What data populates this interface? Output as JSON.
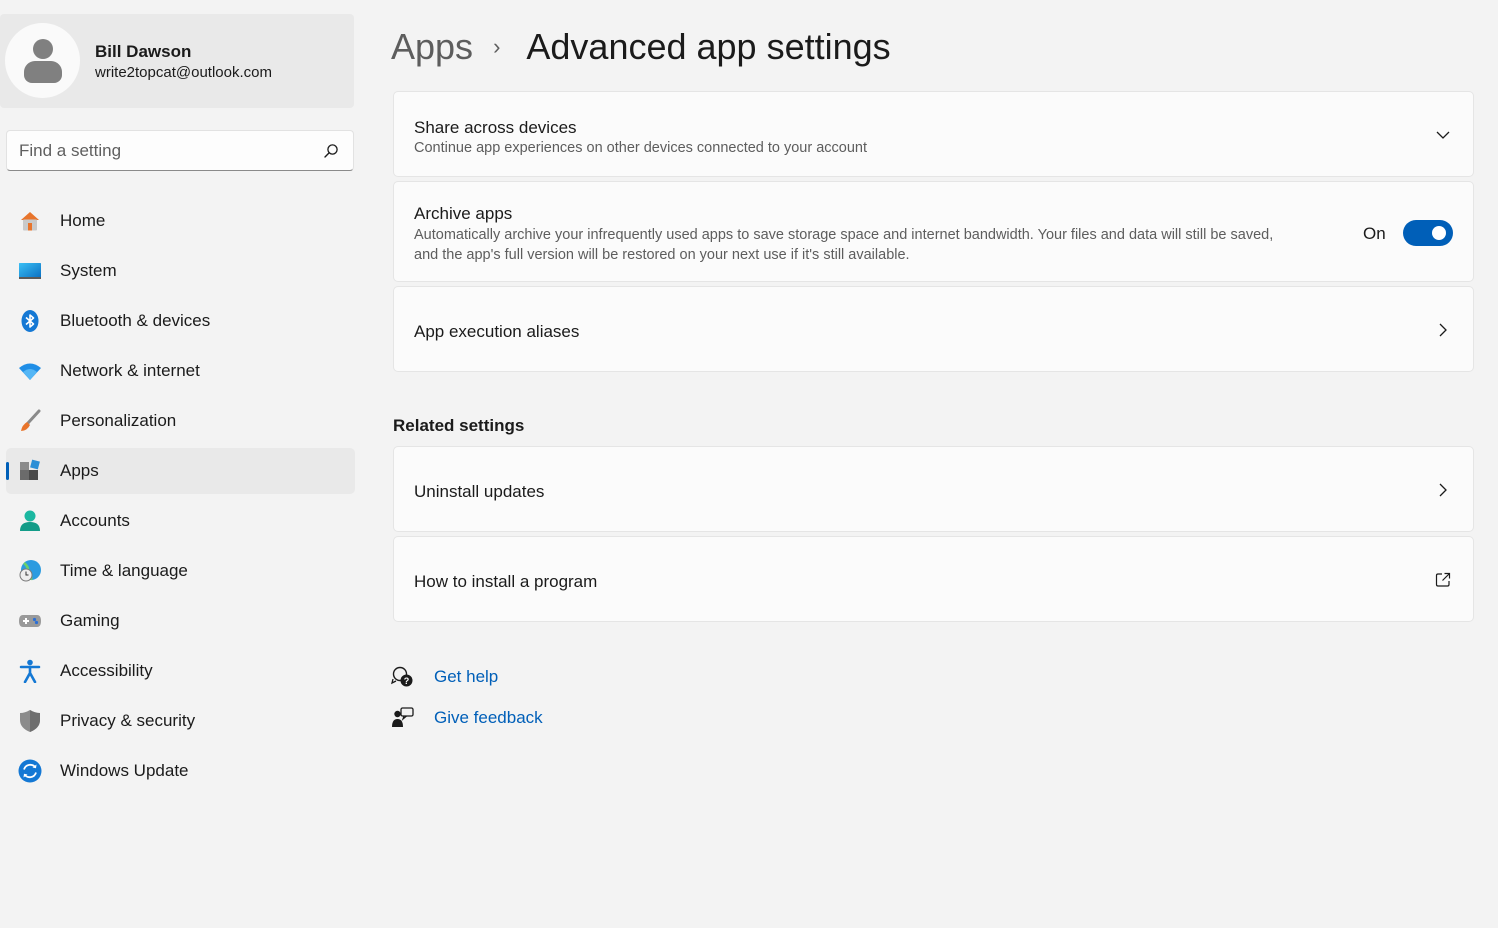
{
  "profile": {
    "name": "Bill Dawson",
    "email": "write2topcat@outlook.com"
  },
  "search": {
    "placeholder": "Find a setting"
  },
  "nav": {
    "items": [
      {
        "label": "Home",
        "icon": "home-icon"
      },
      {
        "label": "System",
        "icon": "system-icon"
      },
      {
        "label": "Bluetooth & devices",
        "icon": "bluetooth-icon"
      },
      {
        "label": "Network & internet",
        "icon": "wifi-icon"
      },
      {
        "label": "Personalization",
        "icon": "brush-icon"
      },
      {
        "label": "Apps",
        "icon": "apps-icon",
        "active": true
      },
      {
        "label": "Accounts",
        "icon": "accounts-icon"
      },
      {
        "label": "Time & language",
        "icon": "time-language-icon"
      },
      {
        "label": "Gaming",
        "icon": "gamepad-icon"
      },
      {
        "label": "Accessibility",
        "icon": "accessibility-icon"
      },
      {
        "label": "Privacy & security",
        "icon": "shield-icon"
      },
      {
        "label": "Windows Update",
        "icon": "update-icon"
      }
    ]
  },
  "breadcrumb": {
    "parent": "Apps",
    "separator": "›",
    "current": "Advanced app settings"
  },
  "cards": {
    "share": {
      "title": "Share across devices",
      "description": "Continue app experiences on other devices connected to your account",
      "icon": "chevron-down-icon"
    },
    "archive": {
      "title": "Archive apps",
      "description_line1": "Automatically archive your infrequently used apps to save storage space and internet bandwidth. Your files and data will still be saved,",
      "description_line2": "and the app's full version will be restored on your next use if it's still available.",
      "toggle_label": "On",
      "toggle_on": true
    },
    "aliases": {
      "title": "App execution aliases",
      "icon": "chevron-right-icon"
    }
  },
  "related": {
    "heading": "Related settings",
    "uninstall": {
      "title": "Uninstall updates",
      "icon": "chevron-right-icon"
    },
    "how_to_install": {
      "title": "How to install a program",
      "icon": "external-link-icon"
    }
  },
  "help": {
    "get_help": "Get help",
    "give_feedback": "Give feedback"
  },
  "colors": {
    "accent": "#005fb8",
    "background": "#f3f3f3",
    "card": "#fbfbfb"
  }
}
